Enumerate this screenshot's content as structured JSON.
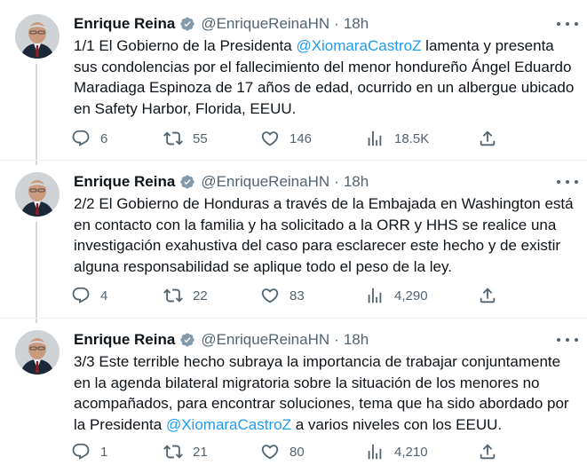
{
  "tweets": [
    {
      "author": {
        "name": "Enrique Reina",
        "handle": "@EnriqueReinaHN"
      },
      "time": "18h",
      "text_parts": [
        "1/1 El Gobierno de la Presidenta ",
        "@XiomaraCastroZ",
        "  lamenta y presenta sus condolencias por el fallecimiento del menor hondureño Ángel Eduardo Maradiaga Espinoza de 17 años de edad, ocurrido en un albergue ubicado en Safety Harbor, Florida, EEUU."
      ],
      "replies": "6",
      "retweets": "55",
      "likes": "146",
      "views": "18.5K"
    },
    {
      "author": {
        "name": "Enrique Reina",
        "handle": "@EnriqueReinaHN"
      },
      "time": "18h",
      "text_parts": [
        "2/2 El Gobierno de Honduras a través de la Embajada en Washington está en contacto con la familia y ha solicitado a la ORR y HHS se realice una investigación exahustiva del caso para esclarecer este hecho y de existir alguna responsabilidad se aplique todo el peso de la ley."
      ],
      "replies": "4",
      "retweets": "22",
      "likes": "83",
      "views": "4,290"
    },
    {
      "author": {
        "name": "Enrique Reina",
        "handle": "@EnriqueReinaHN"
      },
      "time": "18h",
      "text_parts": [
        "3/3 Este terrible hecho subraya la importancia de trabajar conjuntamente en la agenda bilateral migratoria sobre la situación de los menores no acompañados, para encontrar soluciones, tema que ha sido abordado por la Presidenta ",
        "@XiomaraCastroZ",
        " a varios niveles con los EEUU."
      ],
      "replies": "1",
      "retweets": "21",
      "likes": "80",
      "views": "4,210"
    }
  ],
  "colors": {
    "accent": "#1d9bf0",
    "secondary_text": "#536471",
    "primary_text": "#0f1419",
    "thread_line": "#cfd9de"
  }
}
